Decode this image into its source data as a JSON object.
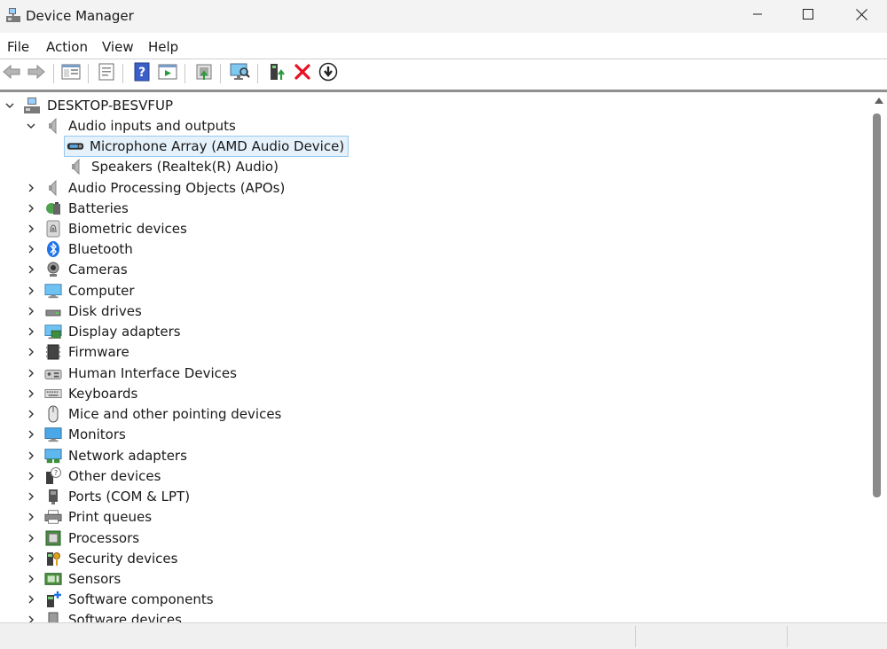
{
  "window": {
    "title": "Device Manager",
    "controls": {
      "minimize": "minimize",
      "maximize": "maximize",
      "close": "close"
    }
  },
  "menu": [
    "File",
    "Action",
    "View",
    "Help"
  ],
  "toolbar": {
    "icons": [
      "back-icon",
      "forward-icon",
      "show-hide-console-tree-icon",
      "properties-icon",
      "help-icon",
      "action-pane-icon",
      "update-driver-software-icon",
      "scan-for-hardware-changes-icon",
      "enable-device-icon",
      "uninstall-device-icon",
      "disable-device-icon"
    ]
  },
  "tree": {
    "root": "DESKTOP-BESVFUP",
    "audio_category": "Audio inputs and outputs",
    "audio_children": [
      "Microphone Array (AMD Audio Device)",
      "Speakers (Realtek(R) Audio)"
    ],
    "categories": [
      "Audio Processing Objects (APOs)",
      "Batteries",
      "Biometric devices",
      "Bluetooth",
      "Cameras",
      "Computer",
      "Disk drives",
      "Display adapters",
      "Firmware",
      "Human Interface Devices",
      "Keyboards",
      "Mice and other pointing devices",
      "Monitors",
      "Network adapters",
      "Other devices",
      "Ports (COM & LPT)",
      "Print queues",
      "Processors",
      "Security devices",
      "Sensors",
      "Software components",
      "Software devices"
    ],
    "selected": "Microphone Array (AMD Audio Device)"
  },
  "colors": {
    "selection_bg": "#e5f1fb",
    "selection_border": "#99c9ef",
    "titlebar_bg": "#f3f3f3",
    "uninstall_red": "#e81123",
    "bluetooth_blue": "#1e73e8"
  }
}
